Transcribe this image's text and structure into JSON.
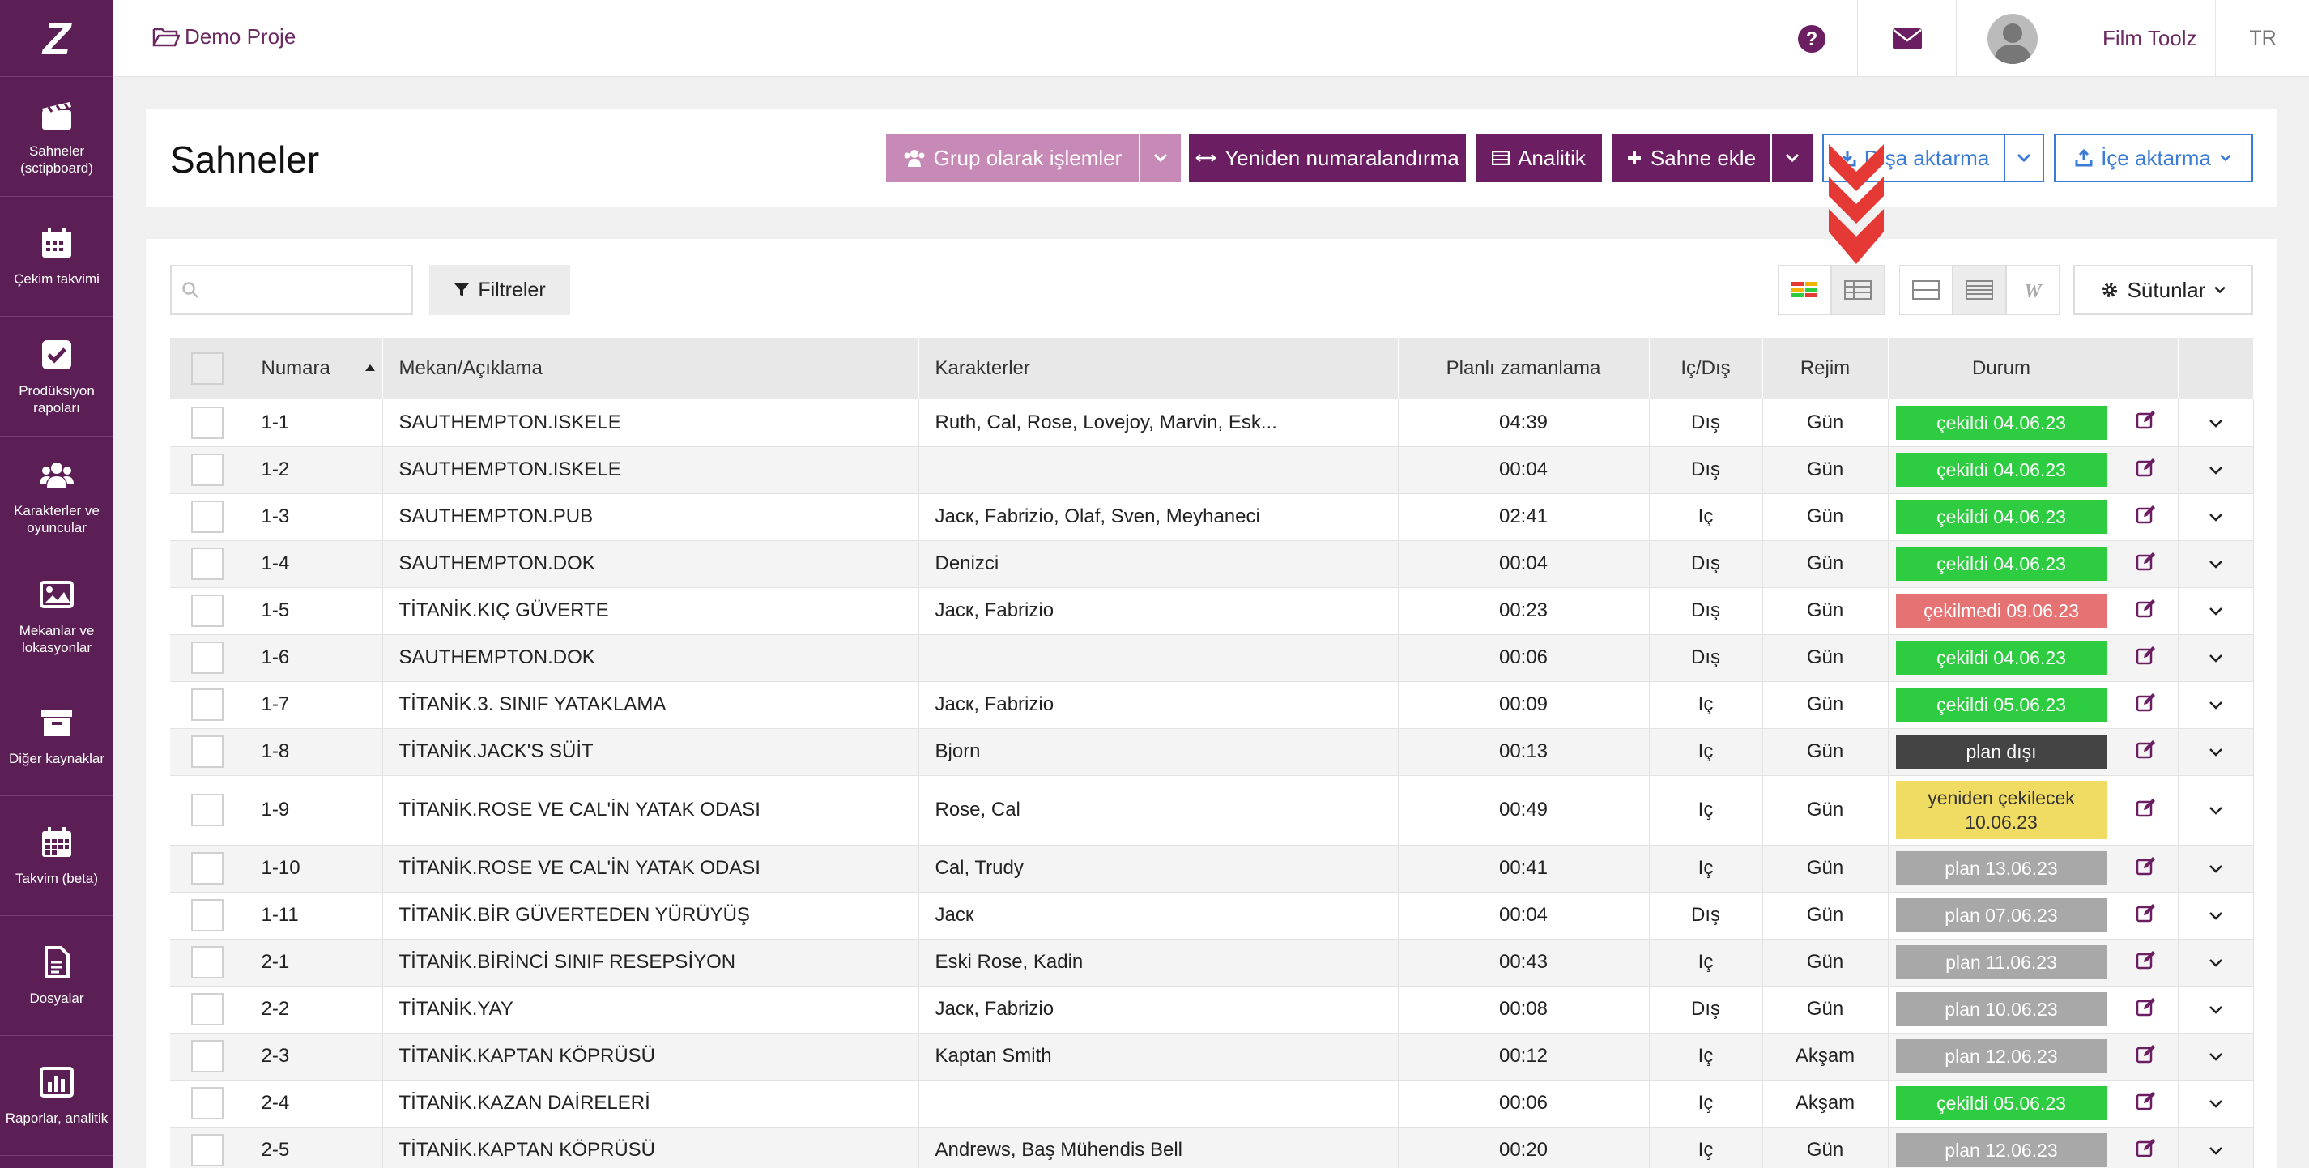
{
  "sidebar": {
    "logo": "Z",
    "items": [
      {
        "label": "Sahneler (sctipboard)",
        "icon": "clapperboard-icon"
      },
      {
        "label": "Çekim takvimi",
        "icon": "calendar-icon"
      },
      {
        "label": "Prodüksiyon rapoları",
        "icon": "checkbox-icon"
      },
      {
        "label": "Karakterler ve oyuncular",
        "icon": "users-icon"
      },
      {
        "label": "Mekanlar ve lokasyonlar",
        "icon": "image-icon"
      },
      {
        "label": "Diğer kaynaklar",
        "icon": "archive-icon"
      },
      {
        "label": "Takvim (beta)",
        "icon": "calendar-grid-icon"
      },
      {
        "label": "Dosyalar",
        "icon": "file-icon"
      },
      {
        "label": "Raporlar, analitik",
        "icon": "bar-chart-icon"
      }
    ]
  },
  "topbar": {
    "project": "Demo Proje",
    "user_name": "Film Toolz",
    "language": "TR"
  },
  "header": {
    "title": "Sahneler",
    "group_ops": "Grup olarak işlemler",
    "renumber": "Yeniden numaralandırma",
    "analytics": "Analitik",
    "add_scene": "Sahne ekle",
    "export": "Dışa aktarma",
    "import": "İçe aktarma"
  },
  "toolbar": {
    "search_placeholder": "",
    "filters": "Filtreler",
    "columns": "Sütunlar"
  },
  "table": {
    "headers": {
      "number": "Numara",
      "location": "Mekan/Açıklama",
      "characters": "Karakterler",
      "planned_time": "Planlı zamanlama",
      "int_ext": "Iç/Dış",
      "mode": "Rejim",
      "status": "Durum"
    },
    "rows": [
      {
        "num": "1-1",
        "loc": "SAUTHEMPTON.ISKELE",
        "chars": "Ruth, Cal, Rose, Lovejoy, Marvin, Esk...",
        "time": "04:39",
        "ie": "Dış",
        "mode": "Gün",
        "status": "çekildi 04.06.23",
        "kind": "green"
      },
      {
        "num": "1-2",
        "loc": "SAUTHEMPTON.ISKELE",
        "chars": "",
        "time": "00:04",
        "ie": "Dış",
        "mode": "Gün",
        "status": "çekildi 04.06.23",
        "kind": "green"
      },
      {
        "num": "1-3",
        "loc": "SAUTHEMPTON.PUB",
        "chars": "Jacк, Fabrizio, Olaf, Sven, Meyhaneci",
        "time": "02:41",
        "ie": "Iç",
        "mode": "Gün",
        "status": "çekildi 04.06.23",
        "kind": "green"
      },
      {
        "num": "1-4",
        "loc": "SAUTHEMPTON.DOK",
        "chars": "Denizci",
        "time": "00:04",
        "ie": "Dış",
        "mode": "Gün",
        "status": "çekildi 04.06.23",
        "kind": "green"
      },
      {
        "num": "1-5",
        "loc": "TİTANİK.KIÇ GÜVERTE",
        "chars": "Jacк, Fabrizio",
        "time": "00:23",
        "ie": "Dış",
        "mode": "Gün",
        "status": "çekilmedi 09.06.23",
        "kind": "red"
      },
      {
        "num": "1-6",
        "loc": "SAUTHEMPTON.DOK",
        "chars": "",
        "time": "00:06",
        "ie": "Dış",
        "mode": "Gün",
        "status": "çekildi 04.06.23",
        "kind": "green"
      },
      {
        "num": "1-7",
        "loc": "TİTANİK.3. SINIF YATAKLAMA",
        "chars": "Jacк, Fabrizio",
        "time": "00:09",
        "ie": "Iç",
        "mode": "Gün",
        "status": "çekildi 05.06.23",
        "kind": "green"
      },
      {
        "num": "1-8",
        "loc": "TİTANİK.JACK'S SÜİT",
        "chars": "Bjorn",
        "time": "00:13",
        "ie": "Iç",
        "mode": "Gün",
        "status": "plan dışı",
        "kind": "dark"
      },
      {
        "num": "1-9",
        "loc": "TİTANİK.ROSE VE CAL'İN YATAK ODASI",
        "chars": "Rose, Cal",
        "time": "00:49",
        "ie": "Iç",
        "mode": "Gün",
        "status": "yeniden çekilecek 10.06.23",
        "kind": "yellow"
      },
      {
        "num": "1-10",
        "loc": "TİTANİK.ROSE VE CAL'İN YATAK ODASI",
        "chars": "Cal, Trudy",
        "time": "00:41",
        "ie": "Iç",
        "mode": "Gün",
        "status": "plan 13.06.23",
        "kind": "grey"
      },
      {
        "num": "1-11",
        "loc": "TİTANİK.BİR GÜVERTEDEN YÜRÜYÜŞ",
        "chars": "Jacк",
        "time": "00:04",
        "ie": "Dış",
        "mode": "Gün",
        "status": "plan 07.06.23",
        "kind": "grey"
      },
      {
        "num": "2-1",
        "loc": "TİTANİK.BİRİNCİ SINIF RESEPSİYON",
        "chars": "Eski Rose, Kadin",
        "time": "00:43",
        "ie": "Iç",
        "mode": "Gün",
        "status": "plan 11.06.23",
        "kind": "grey"
      },
      {
        "num": "2-2",
        "loc": "TİTANİK.YAY",
        "chars": "Jacк, Fabrizio",
        "time": "00:08",
        "ie": "Dış",
        "mode": "Gün",
        "status": "plan 10.06.23",
        "kind": "grey"
      },
      {
        "num": "2-3",
        "loc": "TİTANİK.KAPTAN KÖPRÜSÜ",
        "chars": "Kaptan Smith",
        "time": "00:12",
        "ie": "Iç",
        "mode": "Akşam",
        "status": "plan 12.06.23",
        "kind": "grey"
      },
      {
        "num": "2-4",
        "loc": "TİTANİK.KAZAN DAİRELERİ",
        "chars": "",
        "time": "00:06",
        "ie": "Iç",
        "mode": "Akşam",
        "status": "çekildi 05.06.23",
        "kind": "green"
      },
      {
        "num": "2-5",
        "loc": "TİTANİK.KAPTAN KÖPRÜSÜ",
        "chars": "Andrews, Baş Mühendis Bell",
        "time": "00:20",
        "ie": "Iç",
        "mode": "Gün",
        "status": "plan 12.06.23",
        "kind": "grey"
      }
    ]
  },
  "colors": {
    "sidebar": "#5c1f55",
    "brand_purple": "#6b1f62",
    "status_green": "#2ecc40",
    "status_red": "#e57373",
    "status_dark": "#444444",
    "status_yellow": "#f0dc63",
    "status_grey": "#a8a8a8",
    "accent_blue": "#3a7bd5",
    "arrow_red": "#e53935"
  }
}
